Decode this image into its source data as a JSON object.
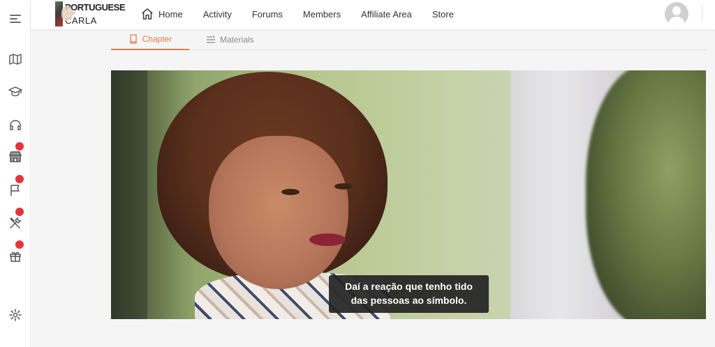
{
  "brand": {
    "line1": "PORTUGUESE",
    "line2": "WITH",
    "line3": "CARLA"
  },
  "nav": {
    "items": [
      {
        "label": "Home",
        "icon": "home-icon"
      },
      {
        "label": "Activity"
      },
      {
        "label": "Forums"
      },
      {
        "label": "Members"
      },
      {
        "label": "Affiliate Area"
      },
      {
        "label": "Store"
      }
    ]
  },
  "sidebar": {
    "items": [
      {
        "icon": "menu-icon"
      },
      {
        "icon": "map-icon"
      },
      {
        "icon": "graduation-cap-icon"
      },
      {
        "icon": "headphones-icon"
      },
      {
        "icon": "store-icon",
        "badge": true
      },
      {
        "icon": "flag-icon",
        "badge": true
      },
      {
        "icon": "tools-icon",
        "badge": true
      },
      {
        "icon": "gift-icon",
        "badge": true
      },
      {
        "icon": "settings-icon"
      }
    ]
  },
  "tabs": [
    {
      "label": "Chapter",
      "active": true,
      "icon": "book-icon"
    },
    {
      "label": "Materials",
      "active": false,
      "icon": "list-icon"
    }
  ],
  "video": {
    "subtitle_line1": "Daí a reação que tenho tido",
    "subtitle_line2": "das pessoas ao símbolo."
  },
  "colors": {
    "accent": "#e37b45",
    "badge": "#e8323c",
    "icon": "#555555",
    "background": "#f5f5f6"
  }
}
